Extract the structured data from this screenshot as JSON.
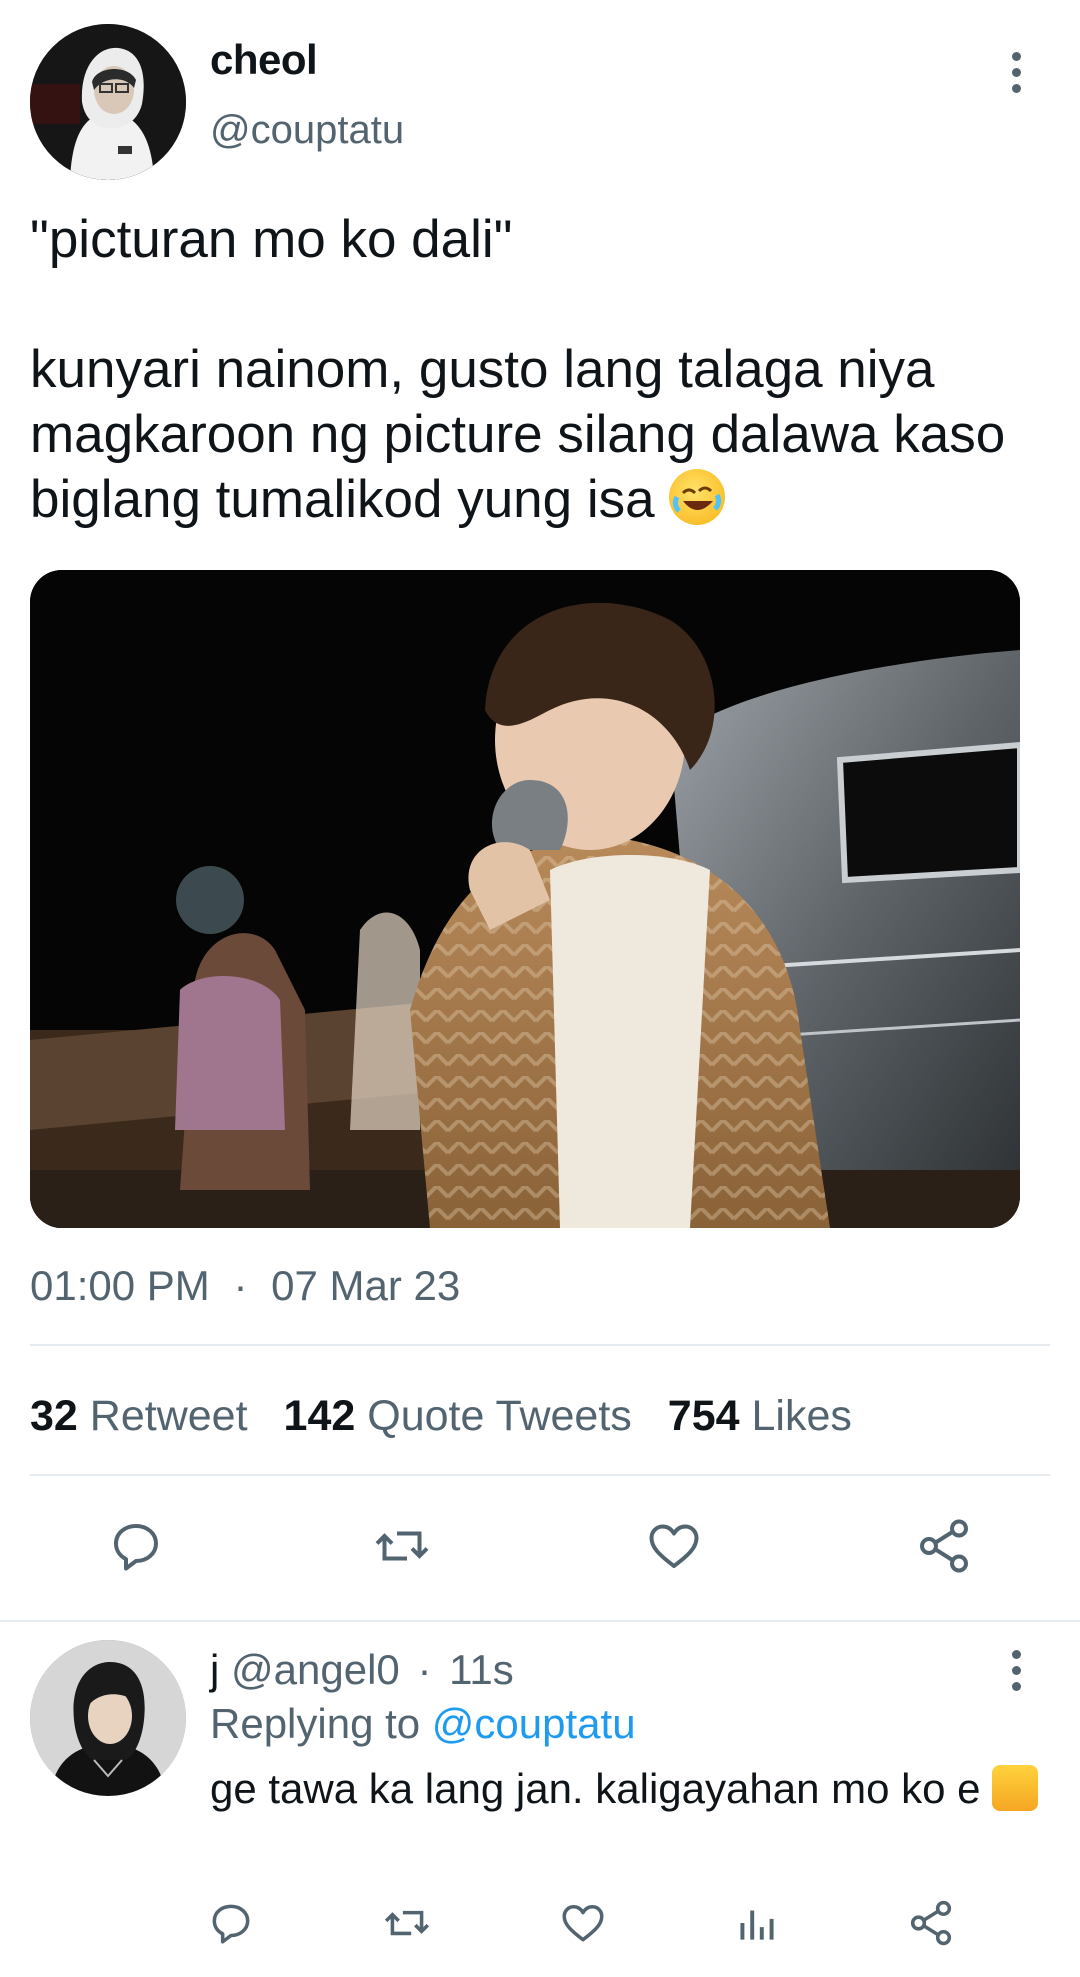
{
  "tweet": {
    "display_name": "cheol",
    "handle": "@couptatu",
    "text_line1": "\"picturan mo ko dali\"",
    "text_body": "kunyari nainom, gusto lang talaga niya magkaroon ng picture silang dalawa kaso biglang tumalikod yung isa",
    "emoji": "rolling-on-the-floor-laughing",
    "time": "01:00 PM",
    "separator": "·",
    "date": "07 Mar 23",
    "stats": {
      "retweets": "32",
      "retweets_label": "Retweet",
      "quotes": "142",
      "quotes_label": "Quote Tweets",
      "likes": "754",
      "likes_label": "Likes"
    },
    "actions": [
      "reply-icon",
      "retweet-icon",
      "like-icon",
      "share-icon"
    ]
  },
  "reply": {
    "display_name": "j",
    "handle": "@angel0",
    "separator": "·",
    "time": "11s",
    "replying_to_label": "Replying to",
    "replying_to_handle": "@couptatu",
    "text": "ge tawa ka lang jan. kaligayahan mo ko e",
    "emoji": "thumbs-up",
    "actions": [
      "reply-icon",
      "retweet-icon",
      "like-icon",
      "analytics-icon",
      "share-icon"
    ]
  },
  "colors": {
    "text": "#0f1419",
    "muted": "#536471",
    "link": "#1d9bf0",
    "divider": "#e6ecf0"
  }
}
